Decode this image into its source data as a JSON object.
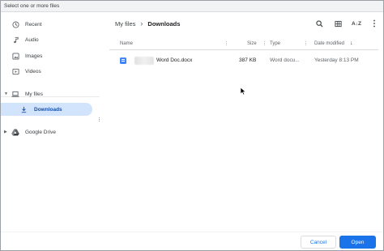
{
  "window": {
    "title": "Select one or more files"
  },
  "sidebar": {
    "items": [
      {
        "label": "Recent",
        "icon": "clock-icon"
      },
      {
        "label": "Audio",
        "icon": "music-note-icon"
      },
      {
        "label": "Images",
        "icon": "image-icon"
      },
      {
        "label": "Videos",
        "icon": "video-icon"
      },
      {
        "label": "My files",
        "icon": "laptop-icon"
      },
      {
        "label": "Downloads",
        "icon": "download-icon",
        "selected": true
      },
      {
        "label": "Google Drive",
        "icon": "google-drive-icon"
      }
    ]
  },
  "breadcrumb": {
    "root": "My files",
    "current": "Downloads"
  },
  "toolbar": {
    "search": "search-icon",
    "grid": "grid-view-icon",
    "sort": "sort-az-icon",
    "more": "more-vertical-icon"
  },
  "file_list": {
    "columns": {
      "name": "Name",
      "size": "Size",
      "type": "Type",
      "date": "Date modified"
    },
    "rows": [
      {
        "name": "Word Doc.docx",
        "size": "387 KB",
        "type": "Word docu...",
        "date": "Yesterday 8:13 PM"
      }
    ]
  },
  "footer": {
    "cancel": "Cancel",
    "open": "Open"
  },
  "colors": {
    "accent": "#1a73e8",
    "selected_bg": "#d2e3fc"
  }
}
